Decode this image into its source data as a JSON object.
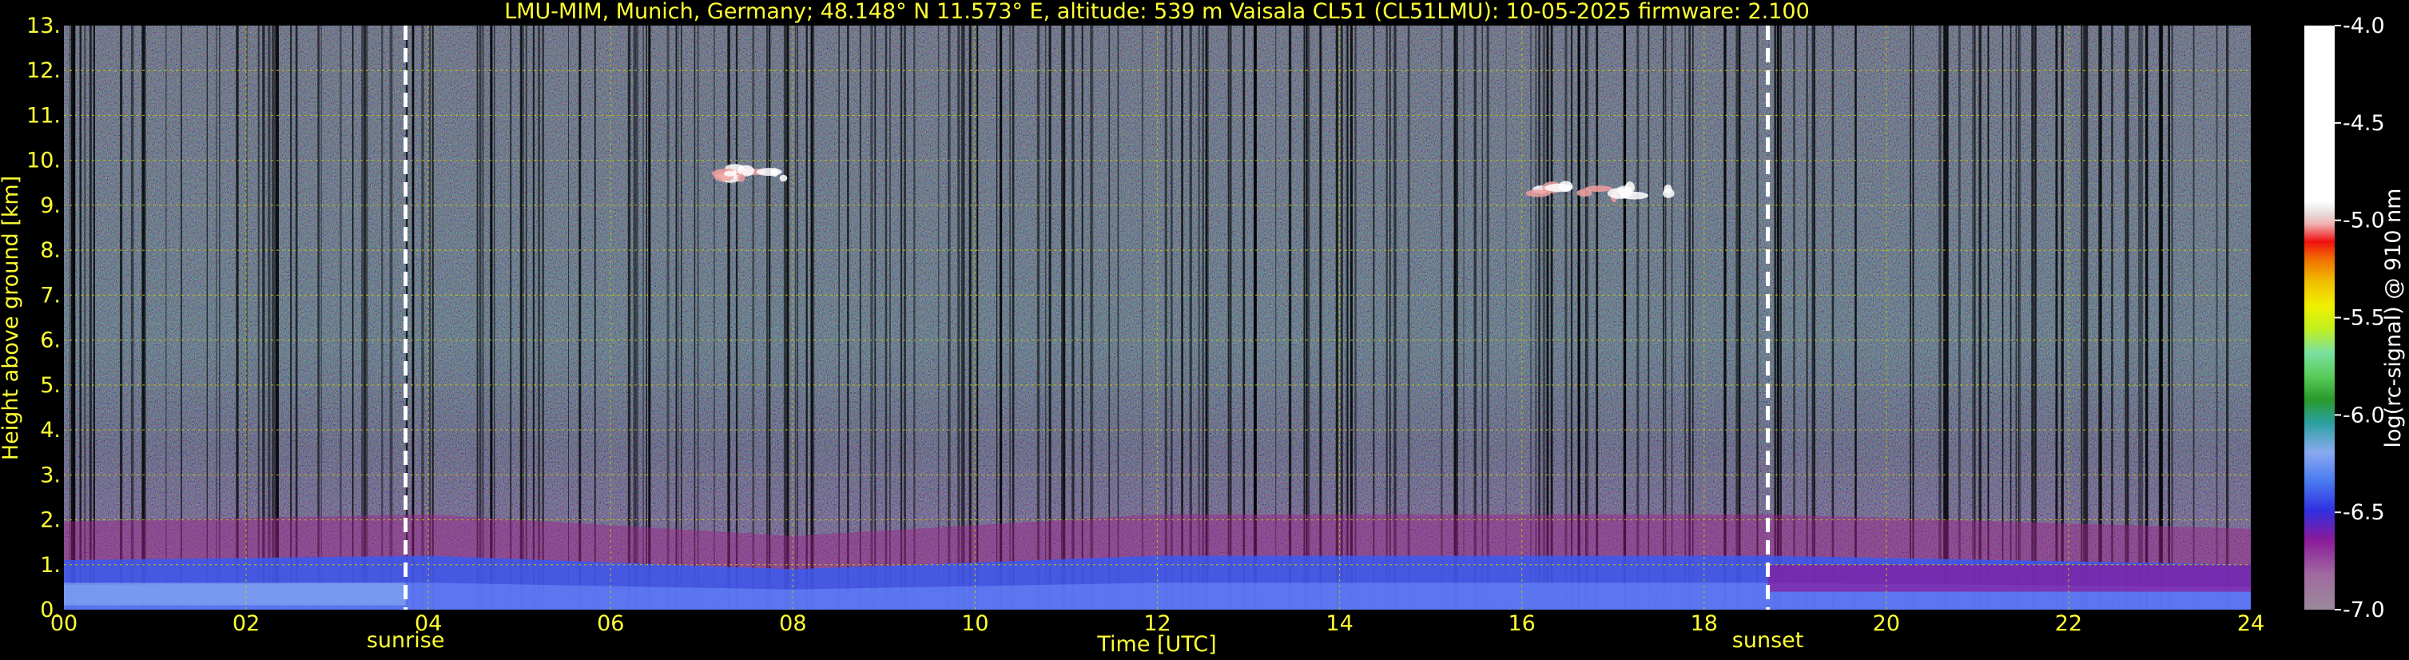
{
  "chart_data": {
    "type": "heatmap",
    "title": "LMU-MIM, Munich, Germany; 48.148° N 11.573° E, altitude: 539 m    Vaisala CL51 (CL51LMU): 10-05-2025    firmware: 2.100",
    "xlabel": "Time [UTC]",
    "ylabel": "Height above ground [km]",
    "x_ticks": [
      "00",
      "02",
      "04",
      "06",
      "08",
      "10",
      "12",
      "14",
      "16",
      "18",
      "20",
      "22",
      "24"
    ],
    "y_ticks": [
      "0.",
      "1.",
      "2.",
      "3.",
      "4.",
      "5.",
      "6.",
      "7.",
      "8.",
      "9.",
      "10.",
      "11.",
      "12.",
      "13."
    ],
    "xlim": [
      0,
      24
    ],
    "ylim": [
      0,
      13
    ],
    "grid": true,
    "events": [
      {
        "label": "sunrise",
        "time": 3.75
      },
      {
        "label": "sunset",
        "time": 18.7
      }
    ],
    "clouds": [
      {
        "time_start": 6.9,
        "time_end": 8.0,
        "height": 9.7
      },
      {
        "time_start": 15.6,
        "time_end": 17.8,
        "height": 9.3
      }
    ],
    "boundary_layer_top_km": [
      {
        "time": 0,
        "height": 1.1
      },
      {
        "time": 4,
        "height": 1.2
      },
      {
        "time": 8,
        "height": 0.9
      },
      {
        "time": 12,
        "height": 1.2
      },
      {
        "time": 18.7,
        "height": 1.2
      },
      {
        "time": 24,
        "height": 1.0
      }
    ],
    "colorbar": {
      "label": "log(rc-signal) @ 910 nm",
      "range": [
        -7.0,
        -4.0
      ],
      "ticks": [
        "-4.0",
        "-4.5",
        "-5.0",
        "-5.5",
        "-6.0",
        "-6.5",
        "-7.0"
      ]
    }
  },
  "colors": {
    "text": "#ffff33",
    "grid": "#c8c800",
    "background": "#000000"
  }
}
